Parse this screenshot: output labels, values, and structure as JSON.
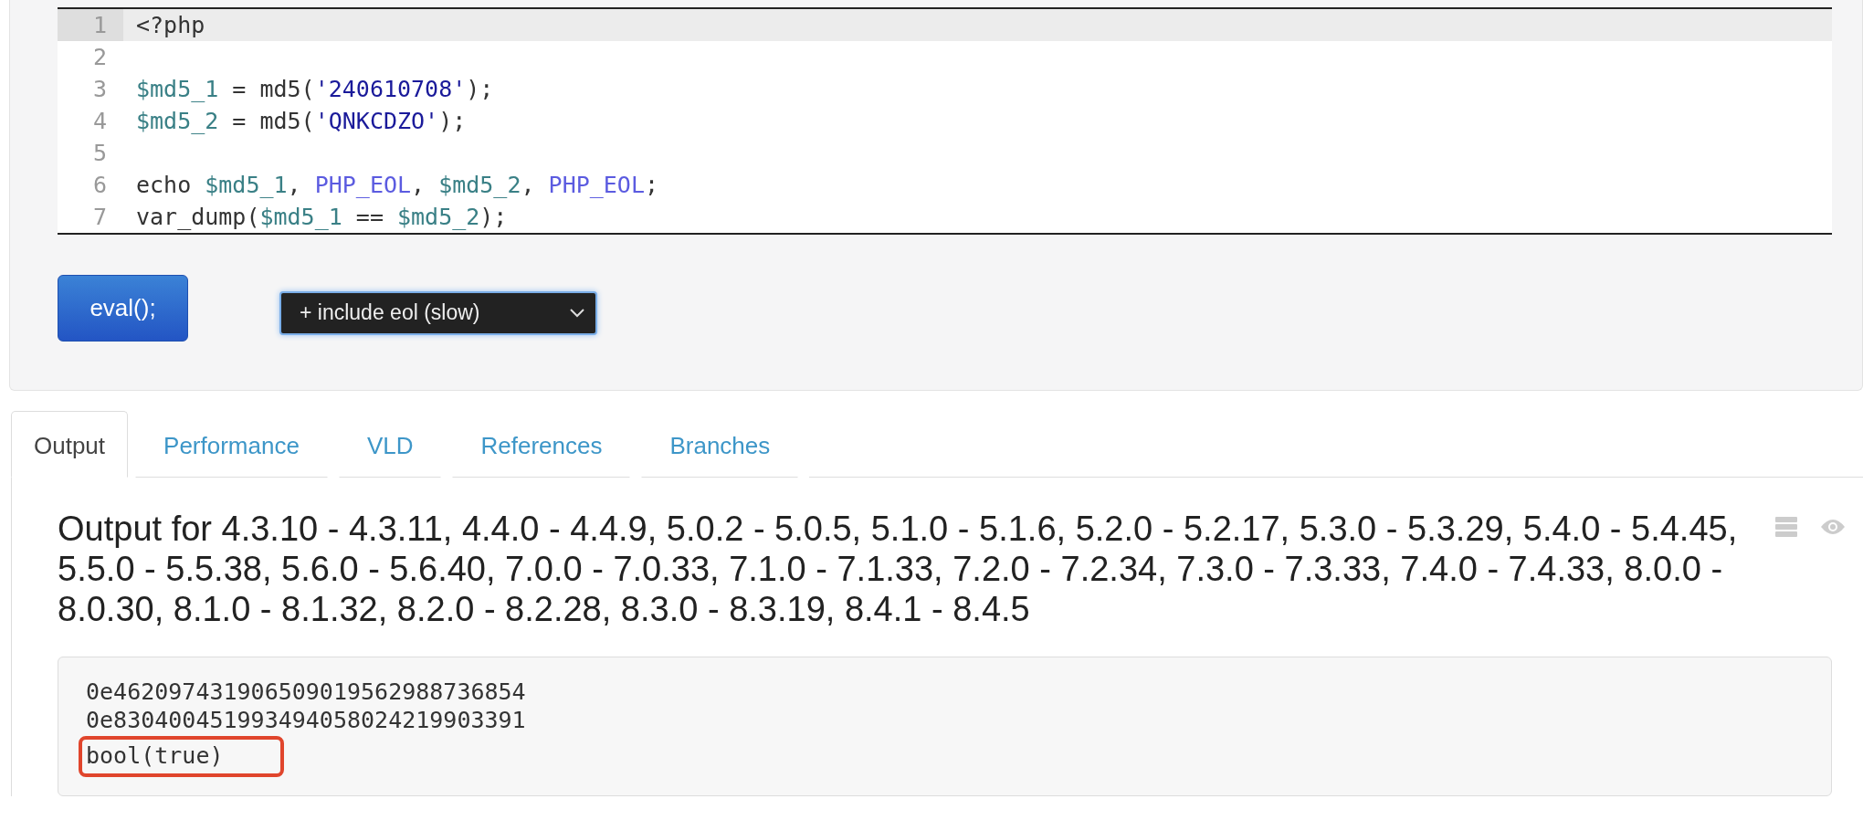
{
  "editor": {
    "lines": [
      {
        "number": "1",
        "active": true,
        "tokens": [
          {
            "kind": "plain",
            "text": "<?php"
          }
        ]
      },
      {
        "number": "2",
        "active": false
      },
      {
        "number": "3",
        "active": false,
        "tokens": [
          {
            "kind": "variable",
            "text": "$md5_1"
          },
          {
            "kind": "plain",
            "text": " = md5("
          },
          {
            "kind": "string",
            "text": "'240610708'"
          },
          {
            "kind": "plain",
            "text": ");"
          }
        ]
      },
      {
        "number": "4",
        "active": false,
        "tokens": [
          {
            "kind": "variable",
            "text": "$md5_2"
          },
          {
            "kind": "plain",
            "text": " = md5("
          },
          {
            "kind": "string",
            "text": "'QNKCDZO'"
          },
          {
            "kind": "plain",
            "text": ");"
          }
        ]
      },
      {
        "number": "5",
        "active": false
      },
      {
        "number": "6",
        "active": false,
        "tokens": [
          {
            "kind": "plain",
            "text": "echo "
          },
          {
            "kind": "variable",
            "text": "$md5_1"
          },
          {
            "kind": "plain",
            "text": ", "
          },
          {
            "kind": "constant",
            "text": "PHP_EOL"
          },
          {
            "kind": "plain",
            "text": ", "
          },
          {
            "kind": "variable",
            "text": "$md5_2"
          },
          {
            "kind": "plain",
            "text": ", "
          },
          {
            "kind": "constant",
            "text": "PHP_EOL"
          },
          {
            "kind": "plain",
            "text": ";"
          }
        ]
      },
      {
        "number": "7",
        "active": false,
        "tokens": [
          {
            "kind": "plain",
            "text": "var_dump("
          },
          {
            "kind": "variable",
            "text": "$md5_1"
          },
          {
            "kind": "plain",
            "text": " == "
          },
          {
            "kind": "variable",
            "text": "$md5_2"
          },
          {
            "kind": "plain",
            "text": ");"
          }
        ]
      }
    ]
  },
  "eval_button": "eval();",
  "mode_select": {
    "value": "+ include eol (slow)"
  },
  "tabs": [
    {
      "label": "Output",
      "selected": true
    },
    {
      "label": "Performance",
      "selected": false
    },
    {
      "label": "VLD",
      "selected": false
    },
    {
      "label": "References",
      "selected": false
    },
    {
      "label": "Branches",
      "selected": false
    }
  ],
  "output": {
    "heading": "Output for 4.3.10 - 4.3.11, 4.4.0 - 4.4.9, 5.0.2 - 5.0.5, 5.1.0 - 5.1.6, 5.2.0 - 5.2.17, 5.3.0 - 5.3.29, 5.4.0 - 5.4.45, 5.5.0 - 5.5.38, 5.6.0 - 5.6.40, 7.0.0 - 7.0.33, 7.1.0 - 7.1.33, 7.2.0 - 7.2.34, 7.3.0 - 7.3.33, 7.4.0 - 7.4.33, 8.0.0 - 8.0.30, 8.1.0 - 8.1.32, 8.2.0 - 8.2.28, 8.3.0 - 8.3.19, 8.4.1 - 8.4.5",
    "lines": [
      {
        "text": "0e462097431906509019562988736854",
        "highlighted": false
      },
      {
        "text": "0e830400451993494058024219903391",
        "highlighted": false
      },
      {
        "text": "bool(true)",
        "highlighted": true
      }
    ]
  }
}
